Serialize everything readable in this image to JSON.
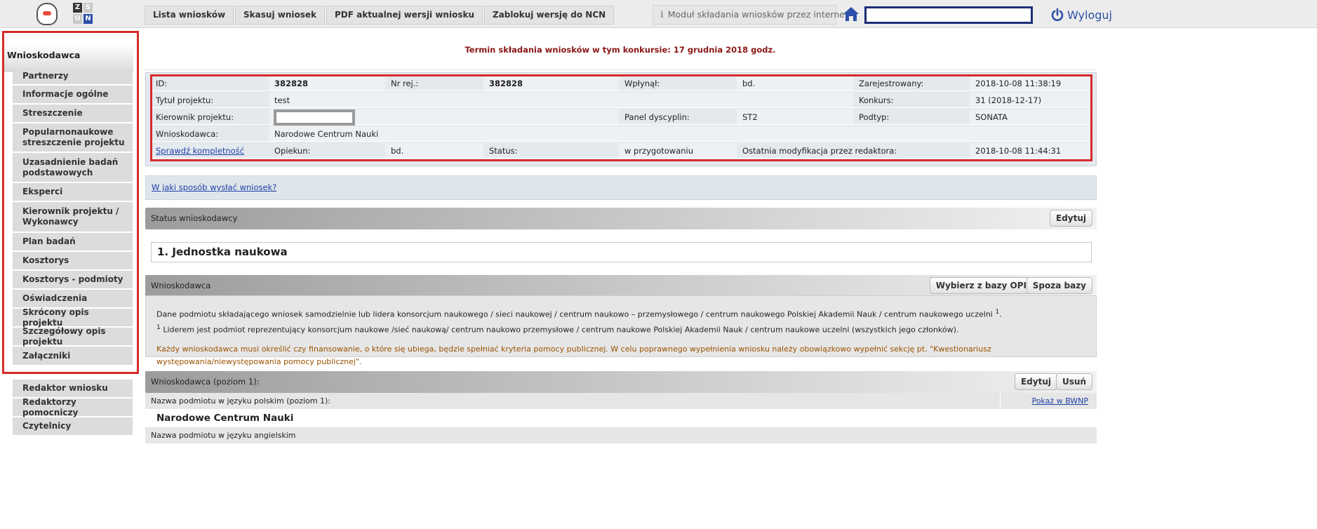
{
  "topbar": {
    "logo2_letters": [
      "Z",
      "S",
      "U",
      "N"
    ],
    "nav": [
      "Lista wniosków",
      "Skasuj wniosek",
      "PDF aktualnej wersji wniosku",
      "Zablokuj wersję do NCN"
    ],
    "module_label": "Moduł składania wniosków przez internet",
    "logout_label": "Wyloguj",
    "search_value": ""
  },
  "sidebar": {
    "header": "Wnioskodawca",
    "items": [
      "Partnerzy",
      "Informacje ogólne",
      "Streszczenie",
      "Popularnonaukowe streszczenie projektu",
      "Uzasadnienie badań podstawowych",
      "Eksperci",
      "Kierownik projektu / Wykonawcy",
      "Plan badań",
      "Kosztorys",
      "Kosztorys - podmioty",
      "Oświadczenia",
      "Skrócony opis projektu",
      "Szczegółowy opis projektu",
      "Załączniki"
    ],
    "bottom_items": [
      "Redaktor wniosku",
      "Redaktorzy pomocniczy",
      "Czytelnicy"
    ]
  },
  "deadline": "Termin składania wniosków w tym konkursie: 17 grudnia 2018 godz.",
  "info": {
    "id_label": "ID:",
    "id_value": "382828",
    "nrrej_label": "Nr rej.:",
    "nrrej_value": "382828",
    "wplynal_label": "Wpłynął:",
    "wplynal_value": "bd.",
    "zarejestrowany_label": "Zarejestrowany:",
    "zarejestrowany_value": "2018-10-08 11:38:19",
    "tytul_label": "Tytuł projektu:",
    "tytul_value": "test",
    "konkurs_label": "Konkurs:",
    "konkurs_value": "31 (2018-12-17)",
    "kierownik_label": "Kierownik projektu:",
    "panel_label": "Panel dyscyplin:",
    "panel_value": "ST2",
    "podtyp_label": "Podtyp:",
    "podtyp_value": "SONATA",
    "wnioskodawca_label": "Wnioskodawca:",
    "wnioskodawca_value": "Narodowe Centrum Nauki",
    "sprawdz_link": "Sprawdź kompletność",
    "opiekun_label": "Opiekun:",
    "opiekun_value": "bd.",
    "status_label": "Status:",
    "status_value": "w przygotowaniu",
    "ostatnia_label": "Ostatnia modyfikacja przez redaktora:",
    "ostatnia_value": "2018-10-08 11:44:31"
  },
  "how_link": "W jaki sposób wysłać wniosek?",
  "status_section": {
    "title": "Status wnioskodawcy",
    "edit": "Edytuj"
  },
  "jednostka": "1. Jednostka naukowa",
  "wnioskodawca_section": {
    "title": "Wnioskodawca",
    "btn_opi": "Wybierz z bazy OPI",
    "btn_spoza": "Spoza bazy"
  },
  "description": {
    "line1": "Dane podmiotu składającego wniosek samodzielnie lub lidera konsorcjum naukowego / sieci naukowej / centrum naukowo – przemysłowego / centrum naukowego Polskiej Akademii Nauk / centrum naukowego uczelni ",
    "sup1": "1",
    "line1_end": ".",
    "sup2": "1",
    "line2": " Liderem jest podmiot reprezentujący konsorcjum naukowe /sieć naukową/ centrum naukowo przemysłowe / centrum naukowe Polskiej Akademii Nauk / centrum naukowe uczelni (wszystkich jego członków).",
    "warning": "Każdy wnioskodawca musi określić czy finansowanie, o które się ubiega, będzie spełniać kryteria pomocy publicznej. W celu poprawnego wypełnienia wniosku należy obowiązkowo wypełnić sekcję pt. \"Kwestionariusz występowania/niewystępowania pomocy publicznej\"."
  },
  "level1_section": {
    "title": "Wnioskodawca (poziom 1):",
    "edit": "Edytuj",
    "remove": "Usuń"
  },
  "nazwa_pl_label": "Nazwa podmiotu w języku polskim (poziom 1):",
  "pokaz_link": "Pokaż w BWNP",
  "nazwa_value": "Narodowe Centrum Nauki",
  "nazwa_en_label": "Nazwa podmiotu w języku angielskim",
  "colors": {
    "frame_red": "#d62b2b",
    "deadline_red": "#8a1616",
    "warning_orange": "#9b5200",
    "link_blue": "#1f3fa8",
    "search_border": "#1c2f78"
  }
}
